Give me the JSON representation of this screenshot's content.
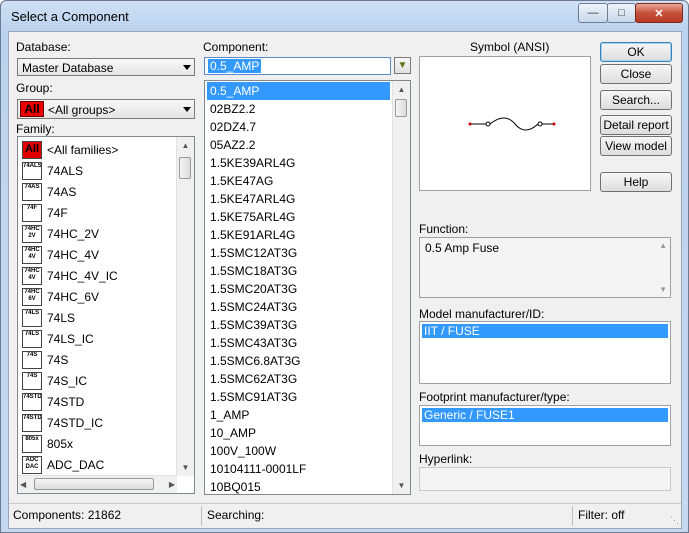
{
  "window": {
    "title": "Select a Component",
    "min": "—",
    "max": "□",
    "close": "✕"
  },
  "database": {
    "label": "Database:",
    "value": "Master Database"
  },
  "group": {
    "label": "Group:",
    "badge": "All",
    "value": "<All groups>"
  },
  "family": {
    "label": "Family:",
    "items": [
      {
        "icon": "All",
        "label": "<All families>"
      },
      {
        "icon": "74ALS",
        "label": "74ALS"
      },
      {
        "icon": "74AS",
        "label": "74AS"
      },
      {
        "icon": "74F",
        "label": "74F"
      },
      {
        "icon": "74HC 2V",
        "label": "74HC_2V"
      },
      {
        "icon": "74HC 4V",
        "label": "74HC_4V"
      },
      {
        "icon": "74HC 4V",
        "label": "74HC_4V_IC"
      },
      {
        "icon": "74HC 6V",
        "label": "74HC_6V"
      },
      {
        "icon": "74LS",
        "label": "74LS"
      },
      {
        "icon": "74LS",
        "label": "74LS_IC"
      },
      {
        "icon": "74S",
        "label": "74S"
      },
      {
        "icon": "74S",
        "label": "74S_IC"
      },
      {
        "icon": "74STD",
        "label": "74STD"
      },
      {
        "icon": "74STD",
        "label": "74STD_IC"
      },
      {
        "icon": "805x",
        "label": "805x"
      },
      {
        "icon": "ADC DAC",
        "label": "ADC_DAC"
      }
    ]
  },
  "component": {
    "label": "Component:",
    "search_value": "0.5_AMP",
    "items": [
      "0.5_AMP",
      "02BZ2.2",
      "02DZ4.7",
      "05AZ2.2",
      "1.5KE39ARL4G",
      "1.5KE47AG",
      "1.5KE47ARL4G",
      "1.5KE75ARL4G",
      "1.5KE91ARL4G",
      "1.5SMC12AT3G",
      "1.5SMC18AT3G",
      "1.5SMC20AT3G",
      "1.5SMC24AT3G",
      "1.5SMC39AT3G",
      "1.5SMC43AT3G",
      "1.5SMC6.8AT3G",
      "1.5SMC62AT3G",
      "1.5SMC91AT3G",
      "1_AMP",
      "10_AMP",
      "100V_100W",
      "10104111-0001LF",
      "10BQ015"
    ],
    "selected_index": 0
  },
  "symbol": {
    "label": "Symbol (ANSI)"
  },
  "buttons": {
    "ok": "OK",
    "close": "Close",
    "search": "Search...",
    "detail": "Detail report",
    "view": "View model",
    "help": "Help"
  },
  "function": {
    "label": "Function:",
    "value": "0.5 Amp Fuse"
  },
  "model": {
    "label": "Model manufacturer/ID:",
    "value": "IIT / FUSE"
  },
  "footprint": {
    "label": "Footprint manufacturer/type:",
    "value": "Generic / FUSE1"
  },
  "hyperlink": {
    "label": "Hyperlink:",
    "value": ""
  },
  "status": {
    "components": "Components: 21862",
    "searching": "Searching:",
    "filter": "Filter: off"
  },
  "colors": {
    "selection": "#3399ff",
    "all_badge": "#e00000"
  }
}
